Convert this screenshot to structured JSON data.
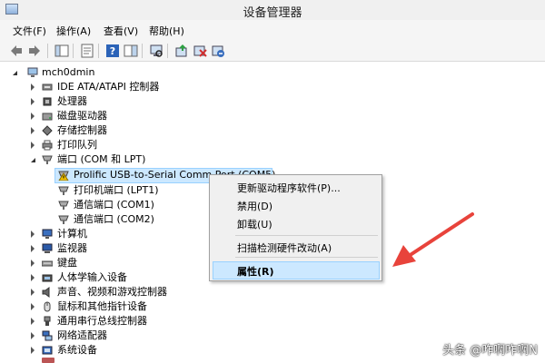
{
  "window": {
    "title": "设备管理器"
  },
  "menu": [
    "文件(F)",
    "操作(A)",
    "查看(V)",
    "帮助(H)"
  ],
  "toolbar_icons": [
    "back-arrow-icon",
    "forward-arrow-icon",
    "show-hide-console-tree-icon",
    "properties-icon",
    "help-icon",
    "action-pane-icon",
    "scan-hardware-icon",
    "update-driver-icon",
    "disable-device-icon",
    "uninstall-device-icon"
  ],
  "tree": {
    "root": "mch0dmin",
    "categories": [
      {
        "label": "IDE ATA/ATAPI 控制器",
        "icon": "ide-controller-icon"
      },
      {
        "label": "处理器",
        "icon": "processor-icon"
      },
      {
        "label": "磁盘驱动器",
        "icon": "disk-drive-icon"
      },
      {
        "label": "存储控制器",
        "icon": "storage-controller-icon"
      },
      {
        "label": "打印队列",
        "icon": "printer-icon"
      },
      {
        "label": "端口 (COM 和 LPT)",
        "icon": "port-icon",
        "expanded": true,
        "children": [
          {
            "label": "Prolific USB-to-Serial Comm Port (COM5)",
            "icon": "warning-port-icon",
            "selected": true
          },
          {
            "label": "打印机端口 (LPT1)",
            "icon": "port-icon"
          },
          {
            "label": "通信端口 (COM1)",
            "icon": "port-icon"
          },
          {
            "label": "通信端口 (COM2)",
            "icon": "port-icon"
          }
        ]
      },
      {
        "label": "计算机",
        "icon": "computer-icon"
      },
      {
        "label": "监视器",
        "icon": "monitor-icon"
      },
      {
        "label": "键盘",
        "icon": "keyboard-icon"
      },
      {
        "label": "人体学输入设备",
        "icon": "hid-icon"
      },
      {
        "label": "声音、视频和游戏控制器",
        "icon": "sound-icon"
      },
      {
        "label": "鼠标和其他指针设备",
        "icon": "mouse-icon"
      },
      {
        "label": "通用串行总线控制器",
        "icon": "usb-icon"
      },
      {
        "label": "网络适配器",
        "icon": "network-adapter-icon"
      },
      {
        "label": "系统设备",
        "icon": "system-device-icon"
      }
    ]
  },
  "context_menu": {
    "items": [
      "更新驱动程序软件(P)...",
      "禁用(D)",
      "卸载(U)",
      "扫描检测硬件改动(A)",
      "属性(R)"
    ],
    "highlighted": "属性(R)"
  },
  "watermark": "头条 @咋啊咋啊N",
  "colors": {
    "selection": "#cce8ff",
    "selection_border": "#99d1ff",
    "arrow": "#e8433b"
  }
}
